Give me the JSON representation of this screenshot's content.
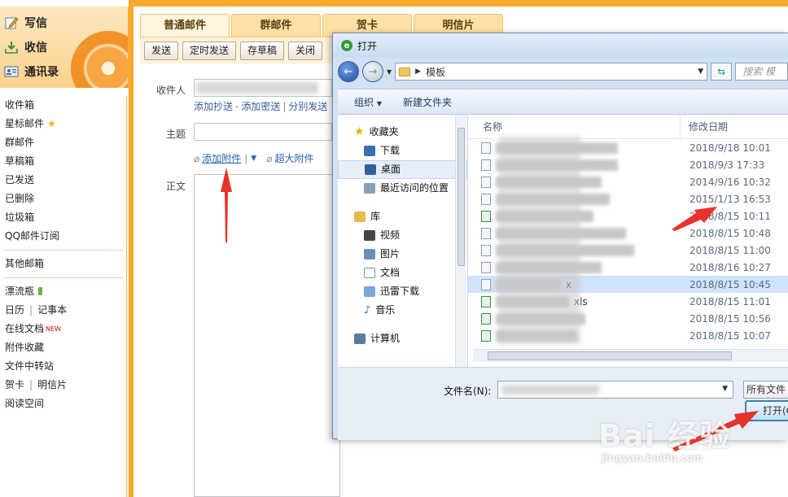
{
  "sidebar": {
    "top_buttons": [
      {
        "label": "写信",
        "icon": "pencil-icon"
      },
      {
        "label": "收信",
        "icon": "inbox-download-icon"
      },
      {
        "label": "通讯录",
        "icon": "contacts-card-icon"
      }
    ],
    "folders": [
      "收件箱",
      "星标邮件",
      "群邮件",
      "草稿箱",
      "已发送",
      "已删除",
      "垃圾箱",
      "QQ邮件订阅"
    ],
    "other_mailboxes": "其他邮箱",
    "apps": {
      "drift_bottle": "漂流瓶",
      "calendar": "日历",
      "notepad": "记事本",
      "online_docs": "在线文档",
      "new_badge": "NEW",
      "attachments": "附件收藏",
      "file_transfer": "文件中转站",
      "greeting_card": "贺卡",
      "postcard": "明信片",
      "reading": "阅读空间",
      "separator": "|"
    }
  },
  "compose": {
    "tabs": [
      "普通邮件",
      "群邮件",
      "贺卡",
      "明信片"
    ],
    "toolbar": {
      "send": "发送",
      "scheduled_send": "定时发送",
      "save_draft": "存草稿",
      "close": "关闭"
    },
    "recipient_label": "收件人",
    "links": {
      "add_cc": "添加抄送",
      "dash": "-",
      "add_bcc": "添加密送",
      "pipe": "|",
      "separate_send": "分别发送"
    },
    "subject_label": "主题",
    "add_attachment": "添加附件",
    "large_attachment": "超大附件",
    "body_label": "正文"
  },
  "dialog": {
    "title": "打开",
    "breadcrumb_arrow": "▶",
    "path": "模板",
    "search_placeholder": "搜索 模",
    "organize": "组织",
    "new_folder": "新建文件夹",
    "tree": {
      "favorites": "收藏夹",
      "downloads": "下载",
      "desktop": "桌面",
      "recent": "最近访问的位置",
      "libraries": "库",
      "videos": "视频",
      "pictures": "图片",
      "documents": "文档",
      "thunder": "迅雷下载",
      "music": "音乐",
      "computer": "计算机"
    },
    "columns": {
      "name": "名称",
      "modified": "修改日期"
    },
    "files": [
      {
        "name_fragment": "",
        "date": "2018/9/18 10:01",
        "type": "doc"
      },
      {
        "name_fragment": "",
        "date": "2018/9/3 17:33",
        "type": "vpn"
      },
      {
        "name_fragment": "",
        "date": "2014/9/16 10:32",
        "type": "blank"
      },
      {
        "name_fragment": "",
        "date": "2015/1/13 16:53",
        "type": "blank"
      },
      {
        "name_fragment": "",
        "date": "2018/8/15 10:11",
        "type": "xls"
      },
      {
        "name_fragment": "",
        "date": "2018/8/15 10:48",
        "type": "doc"
      },
      {
        "name_fragment": "",
        "date": "2018/8/15 11:00",
        "type": "doc"
      },
      {
        "name_fragment": "",
        "date": "2018/8/16 10:27",
        "type": "doc"
      },
      {
        "name_fragment": "x",
        "date": "2018/8/15 10:45",
        "type": "doc"
      },
      {
        "name_fragment": "xls",
        "date": "2018/8/15 11:01",
        "type": "xls"
      },
      {
        "name_fragment": "",
        "date": "2018/8/15 10:56",
        "type": "xls"
      },
      {
        "name_fragment": "",
        "date": "2018/8/15 10:07",
        "type": "xls"
      }
    ],
    "filename_label": "文件名(N):",
    "filetype": "所有文件",
    "open_button": "打开(O"
  },
  "watermark": {
    "brand": "Bai 经验",
    "url": "jingyan.baidu.com"
  },
  "colors": {
    "brand_orange": "#f7a928",
    "link_blue": "#2a5fa8",
    "selected_row": "#cfe3f9",
    "arrow_red": "#e8322a"
  }
}
